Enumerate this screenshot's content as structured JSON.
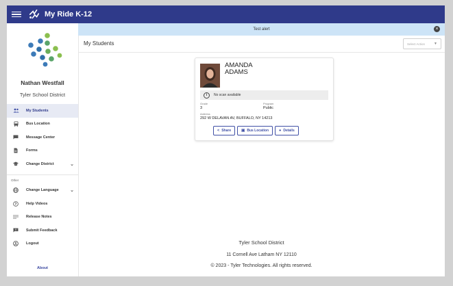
{
  "app": {
    "title": "My Ride K-12"
  },
  "user": {
    "name": "Nathan Westfall",
    "district": "Tyler School District"
  },
  "sidebar": {
    "items": [
      {
        "label": "My Students",
        "icon": "students-icon",
        "active": true
      },
      {
        "label": "Bus Location",
        "icon": "bus-icon"
      },
      {
        "label": "Message Center",
        "icon": "message-icon"
      },
      {
        "label": "Forms",
        "icon": "forms-icon"
      },
      {
        "label": "Change District",
        "icon": "school-icon",
        "has_chevron": true
      }
    ],
    "other_label": "Other",
    "other_items": [
      {
        "label": "Change Language",
        "icon": "globe-icon",
        "has_chevron": true
      },
      {
        "label": "Help Videos",
        "icon": "help-icon"
      },
      {
        "label": "Release Notes",
        "icon": "notes-icon"
      },
      {
        "label": "Submit Feedback",
        "icon": "feedback-icon"
      },
      {
        "label": "Logout",
        "icon": "logout-icon"
      }
    ],
    "about": "About"
  },
  "alert": {
    "text": "Test alert"
  },
  "main": {
    "title": "My Students",
    "select_action": "Select Action"
  },
  "student": {
    "first_name": "AMANDA",
    "last_name": "ADAMS",
    "scan_status": "No scan available",
    "grade_label": "Grade",
    "grade": "3",
    "program_label": "Program",
    "program": "Public",
    "address_label": "Address",
    "address": "292 W DELAVAN AV, BUFFALO, NY 14213",
    "actions": {
      "share": "Share",
      "bus_location": "Bus Location",
      "details": "Details"
    }
  },
  "footer": {
    "district": "Tyler School District",
    "address": "11 Cornell Ave Latham NY 12110",
    "copyright": "© 2023 - Tyler Technologies. All rights reserved."
  },
  "colors": {
    "topbar": "#2f3a8a",
    "accent": "#3f4fa5",
    "alert": "#cde4f7"
  }
}
